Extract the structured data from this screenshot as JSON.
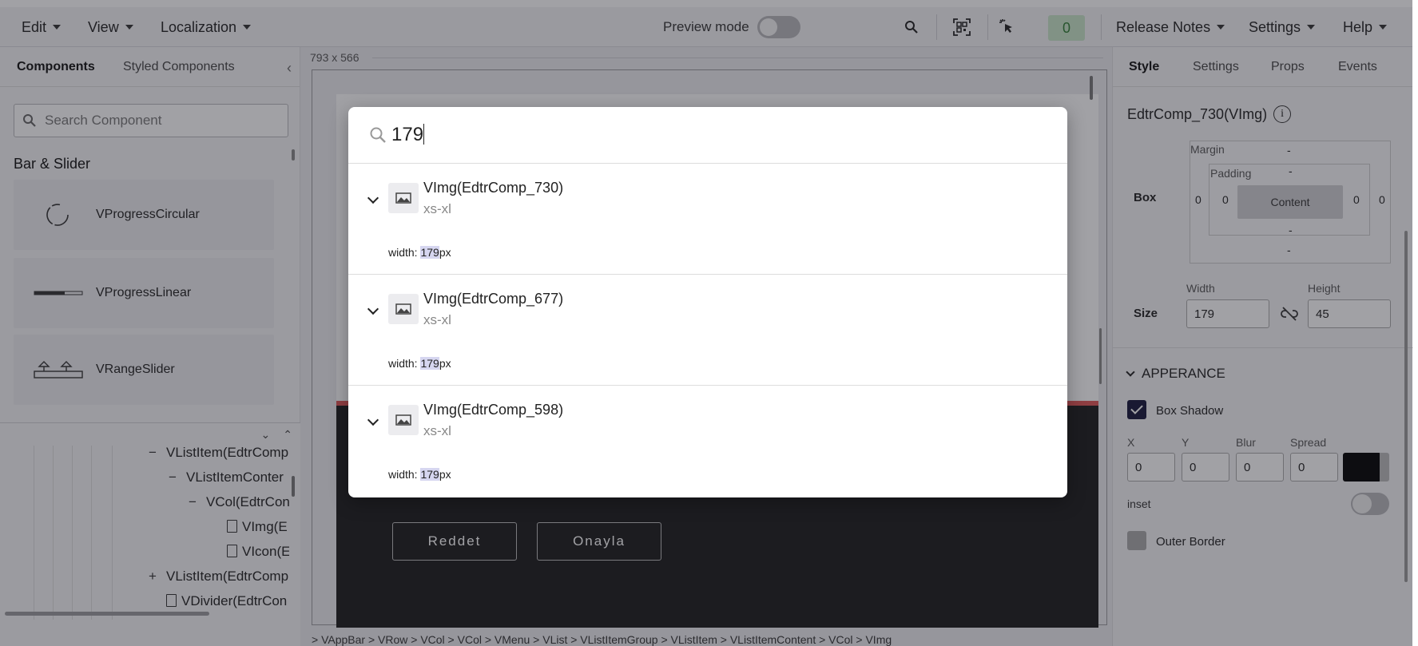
{
  "toolbar": {
    "edit": "Edit",
    "view": "View",
    "localization": "Localization",
    "preview_label": "Preview mode",
    "counter": "0",
    "release_notes": "Release Notes",
    "settings": "Settings",
    "help": "Help"
  },
  "left": {
    "tabs": [
      "Components",
      "Styled Components"
    ],
    "search_placeholder": "Search Component",
    "category": "Bar & Slider",
    "components": [
      {
        "label": "VProgressCircular",
        "icon": "progress-circular-icon"
      },
      {
        "label": "VProgressLinear",
        "icon": "progress-linear-icon"
      },
      {
        "label": "VRangeSlider",
        "icon": "range-slider-icon"
      }
    ],
    "tree": [
      {
        "sign": "−",
        "label": "VListItem(EdtrComp"
      },
      {
        "sign": "−",
        "label": "VListItemConter"
      },
      {
        "sign": "−",
        "label": "VCol(EdtrCon"
      },
      {
        "sign": "file",
        "label": "VImg(E"
      },
      {
        "sign": "file",
        "label": "VIcon(E"
      },
      {
        "sign": "+",
        "label": "VListItem(EdtrComp"
      },
      {
        "sign": "file",
        "label": "VDivider(EdtrCon"
      }
    ]
  },
  "canvas": {
    "dimensions": "793 x 566",
    "buttons": [
      "Reddet",
      "Onayla"
    ],
    "breadcrumb": "> VAppBar > VRow > VCol > VCol > VMenu > VList > VListItemGroup > VListItem > VListItemContent > VCol > VImg"
  },
  "right": {
    "tabs": [
      "Style",
      "Settings",
      "Props",
      "Events"
    ],
    "component_name": "EdtrComp_730(VImg)",
    "box": {
      "label": "Box",
      "margin_label": "Margin",
      "padding_label": "Padding",
      "content_label": "Content",
      "margin_top": "-",
      "margin_bottom": "-",
      "margin_left": "0",
      "margin_right": "0",
      "padding_top": "-",
      "padding_bottom": "-",
      "padding_left": "0",
      "padding_right": "0"
    },
    "size": {
      "label": "Size",
      "width_label": "Width",
      "width": "179",
      "height_label": "Height",
      "height": "45"
    },
    "appearance_title": "APPERANCE",
    "box_shadow": {
      "label": "Box Shadow",
      "checked": true,
      "x_label": "X",
      "y_label": "Y",
      "blur_label": "Blur",
      "spread_label": "Spread",
      "x": "0",
      "y": "0",
      "blur": "0",
      "spread": "0",
      "color": "#000000"
    },
    "inset_label": "inset",
    "outer_border_label": "Outer Border"
  },
  "search_modal": {
    "query": "179",
    "results": [
      {
        "title": "VImg(EdtrComp_730)",
        "sub": "xs-xl",
        "match_prefix": "width: ",
        "match": "179",
        "match_suffix": "px"
      },
      {
        "title": "VImg(EdtrComp_677)",
        "sub": "xs-xl",
        "match_prefix": "width: ",
        "match": "179",
        "match_suffix": "px"
      },
      {
        "title": "VImg(EdtrComp_598)",
        "sub": "xs-xl",
        "match_prefix": "width: ",
        "match": "179",
        "match_suffix": "px"
      }
    ]
  }
}
